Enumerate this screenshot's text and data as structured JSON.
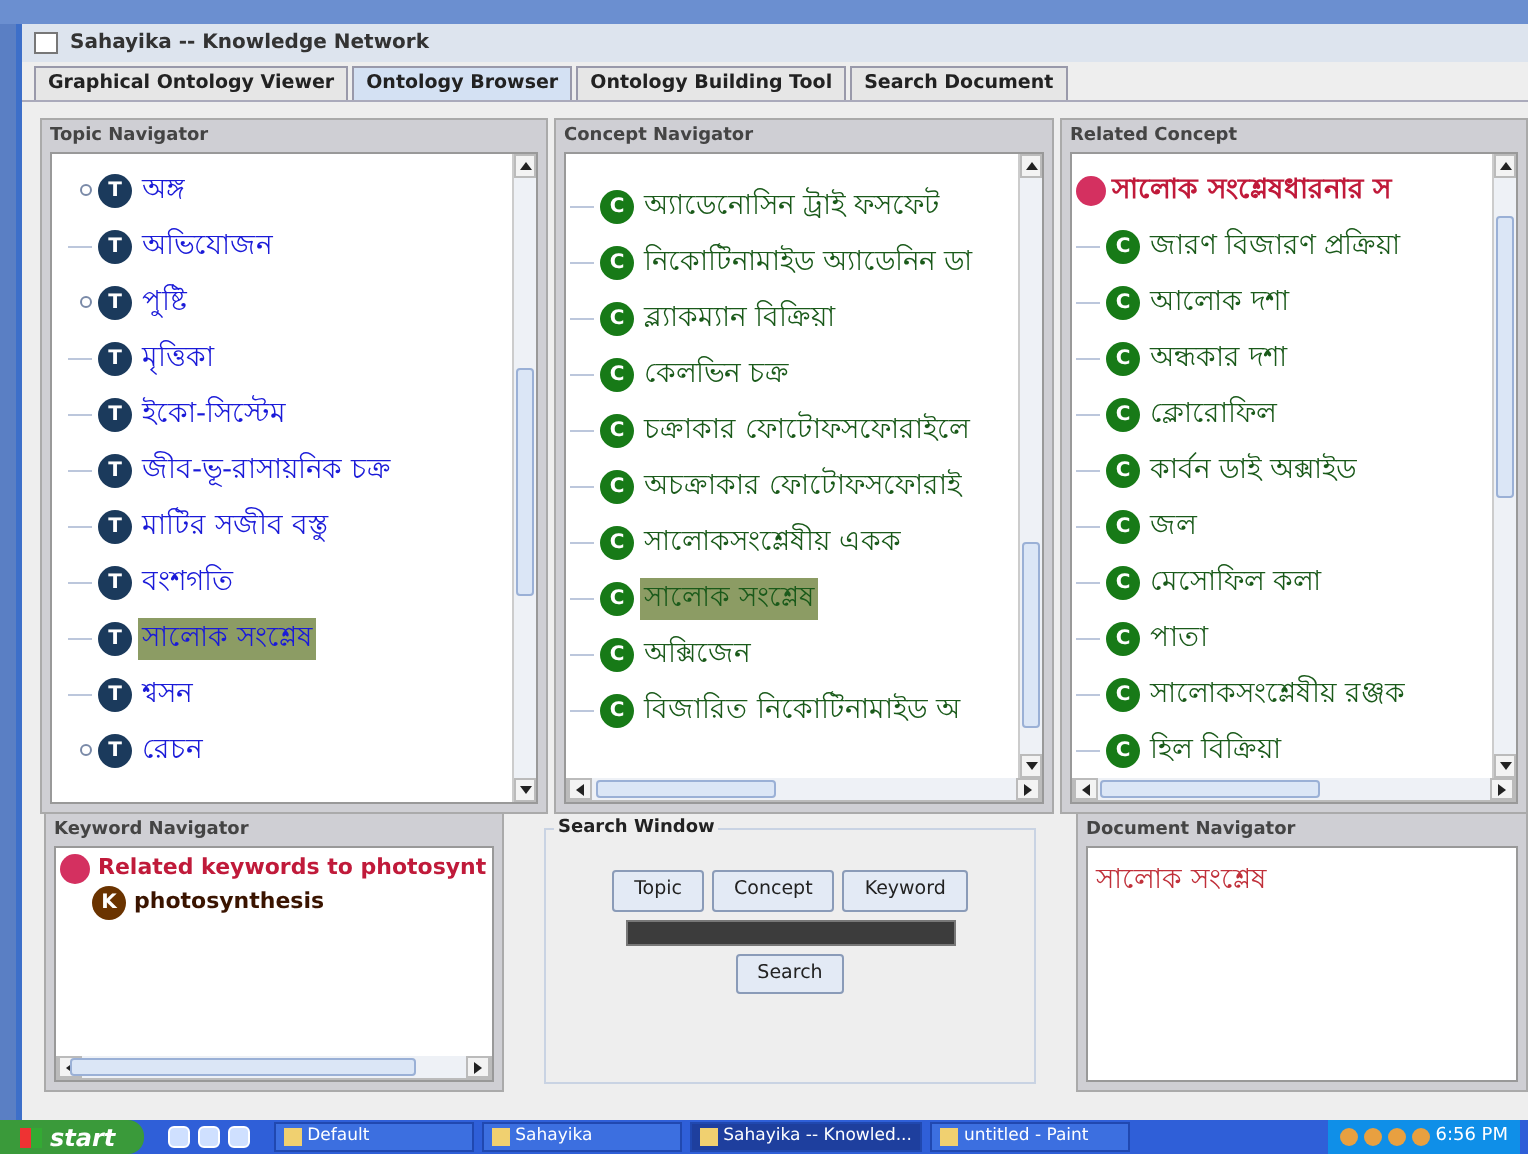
{
  "window": {
    "title": "Sahayika -- Knowledge Network"
  },
  "tabs": [
    {
      "label": "Graphical Ontology Viewer",
      "selected": false
    },
    {
      "label": "Ontology Browser",
      "selected": true
    },
    {
      "label": "Ontology Building Tool",
      "selected": false
    },
    {
      "label": "Search Document",
      "selected": false
    }
  ],
  "topic_navigator": {
    "title": "Topic Navigator",
    "items": [
      {
        "icon": "T",
        "label": "অঙ্গ",
        "collapsed": true,
        "selected": false
      },
      {
        "icon": "T",
        "label": "অভিযোজন",
        "collapsed": false,
        "selected": false
      },
      {
        "icon": "T",
        "label": "পুষ্টি",
        "collapsed": true,
        "selected": false
      },
      {
        "icon": "T",
        "label": "মৃত্তিকা",
        "collapsed": false,
        "selected": false
      },
      {
        "icon": "T",
        "label": "ইকো-সিস্টেম",
        "collapsed": false,
        "selected": false
      },
      {
        "icon": "T",
        "label": "জীব-ভূ-রাসায়নিক চক্র",
        "collapsed": false,
        "selected": false
      },
      {
        "icon": "T",
        "label": "মাটির সজীব বস্তু",
        "collapsed": false,
        "selected": false
      },
      {
        "icon": "T",
        "label": "বংশগতি",
        "collapsed": false,
        "selected": false
      },
      {
        "icon": "T",
        "label": "সালোক সংশ্লেষ",
        "collapsed": false,
        "selected": true
      },
      {
        "icon": "T",
        "label": "শ্বসন",
        "collapsed": false,
        "selected": false
      },
      {
        "icon": "T",
        "label": "রেচন",
        "collapsed": true,
        "selected": false
      }
    ]
  },
  "concept_navigator": {
    "title": "Concept Navigator",
    "items": [
      {
        "icon": "C",
        "label": "অ্যাডেনোসিন ট্রাই ফসফেট",
        "selected": false
      },
      {
        "icon": "C",
        "label": "নিকোটিনামাইড অ্যাডেনিন ডা",
        "selected": false
      },
      {
        "icon": "C",
        "label": "ব্ল্যাকম্যান বিক্রিয়া",
        "selected": false
      },
      {
        "icon": "C",
        "label": "কেলভিন চক্র",
        "selected": false
      },
      {
        "icon": "C",
        "label": "চক্রাকার ফোটোফসফোরাইলে",
        "selected": false
      },
      {
        "icon": "C",
        "label": "অচক্রাকার ফোটোফসফোরাই",
        "selected": false
      },
      {
        "icon": "C",
        "label": "সালোকসংশ্লেষীয় একক",
        "selected": false
      },
      {
        "icon": "C",
        "label": "সালোক সংশ্লেষ",
        "selected": true
      },
      {
        "icon": "C",
        "label": "অক্সিজেন",
        "selected": false
      },
      {
        "icon": "C",
        "label": "বিজারিত নিকোটিনামাইড অ",
        "selected": false
      }
    ]
  },
  "related_concept": {
    "title": "Related Concept",
    "root": "সালোক সংশ্লেষধারনার স",
    "items": [
      {
        "icon": "C",
        "label": "জারণ বিজারণ প্রক্রিয়া"
      },
      {
        "icon": "C",
        "label": "আলোক দশা"
      },
      {
        "icon": "C",
        "label": "অন্ধকার দশা"
      },
      {
        "icon": "C",
        "label": "ক্লোরোফিল"
      },
      {
        "icon": "C",
        "label": "কার্বন ডাই অক্সাইড"
      },
      {
        "icon": "C",
        "label": "জল"
      },
      {
        "icon": "C",
        "label": "মেসোফিল কলা"
      },
      {
        "icon": "C",
        "label": "পাতা"
      },
      {
        "icon": "C",
        "label": "সালোকসংশ্লেষীয় রঞ্জক"
      },
      {
        "icon": "C",
        "label": "হিল বিক্রিয়া"
      }
    ]
  },
  "keyword_navigator": {
    "title": "Keyword Navigator",
    "root": "Related keywords to photosynt",
    "items": [
      {
        "icon": "K",
        "label": "photosynthesis"
      }
    ]
  },
  "search_window": {
    "title": "Search Window",
    "buttons": [
      "Topic",
      "Concept",
      "Keyword"
    ],
    "search_button": "Search"
  },
  "document_navigator": {
    "title": "Document Navigator",
    "items": [
      "সালোক সংশ্লেষ"
    ]
  },
  "taskbar": {
    "start": "start",
    "items": [
      {
        "label": "Default",
        "selected": false
      },
      {
        "label": "Sahayika",
        "selected": false
      },
      {
        "label": "Sahayika -- Knowled...",
        "selected": true
      },
      {
        "label": "untitled - Paint",
        "selected": false
      }
    ],
    "clock": "6:56 PM"
  }
}
